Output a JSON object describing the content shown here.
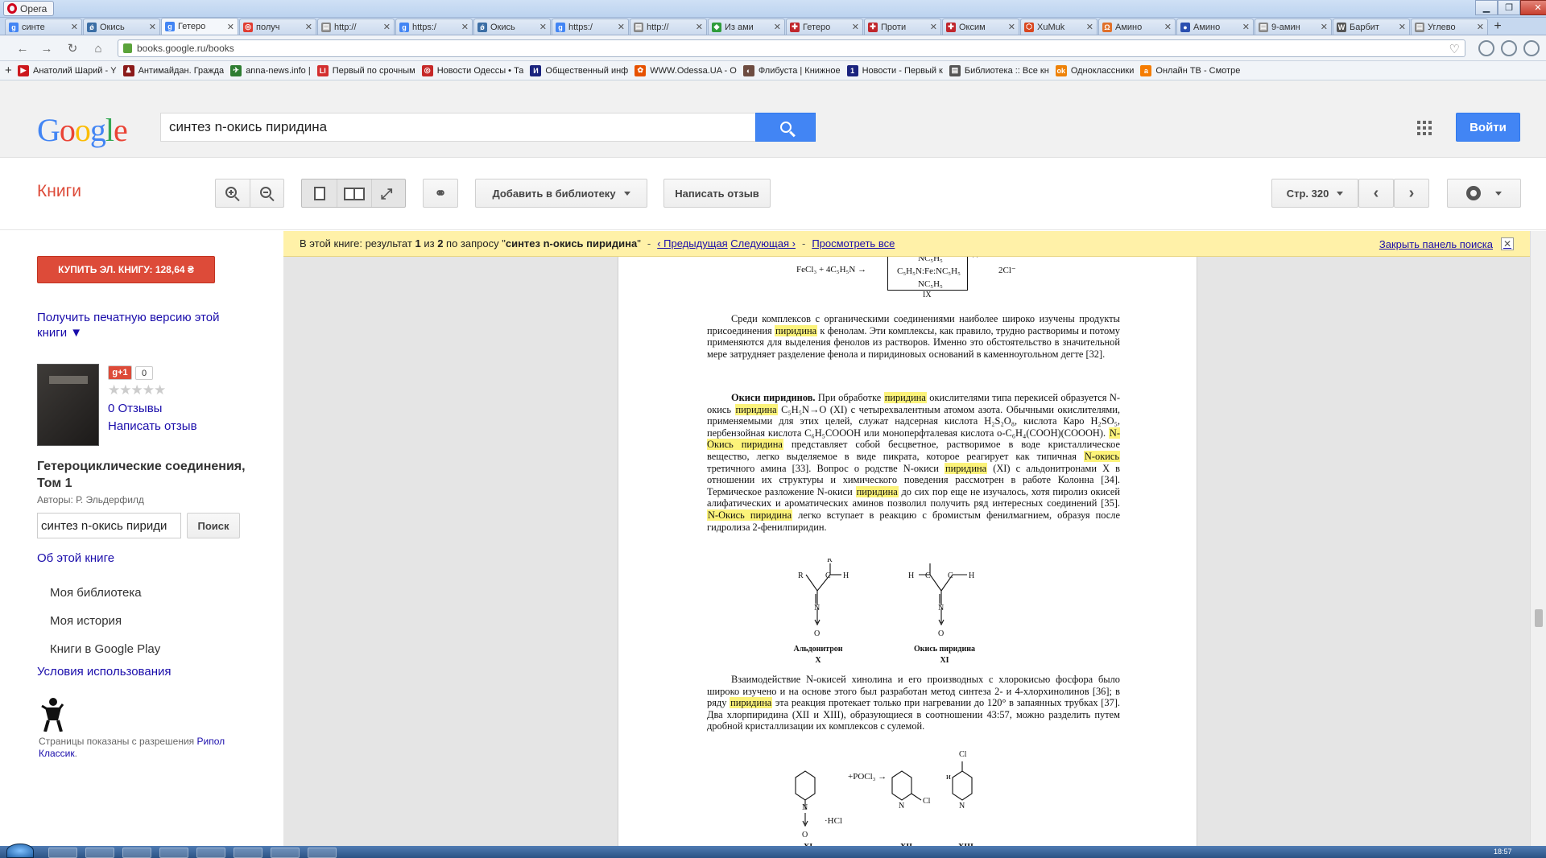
{
  "browser": {
    "app_name": "Opera",
    "tabs": [
      {
        "title": "синте",
        "fav": "g",
        "color": "#4285f4"
      },
      {
        "title": "Окись",
        "fav": "ǿ",
        "color": "#3b6ea5"
      },
      {
        "title": "Гетеро",
        "fav": "g",
        "color": "#4285f4",
        "active": true
      },
      {
        "title": "получ",
        "fav": "◎",
        "color": "#e03c31"
      },
      {
        "title": "http://",
        "fav": "▤",
        "color": "#888888"
      },
      {
        "title": "https:/",
        "fav": "g",
        "color": "#4285f4"
      },
      {
        "title": "Окись",
        "fav": "ǿ",
        "color": "#3b6ea5"
      },
      {
        "title": "https:/",
        "fav": "g",
        "color": "#4285f4"
      },
      {
        "title": "http://",
        "fav": "▤",
        "color": "#888888"
      },
      {
        "title": "Из ами",
        "fav": "◆",
        "color": "#2e9c3a"
      },
      {
        "title": "Гетеро",
        "fav": "✚",
        "color": "#c0262c"
      },
      {
        "title": "Проти",
        "fav": "✚",
        "color": "#c0262c"
      },
      {
        "title": "Оксим",
        "fav": "✚",
        "color": "#c0262c"
      },
      {
        "title": "XuMuk",
        "fav": "⬡",
        "color": "#d9461e"
      },
      {
        "title": "Амино",
        "fav": "Ω",
        "color": "#e0702a"
      },
      {
        "title": "Амино",
        "fav": "●",
        "color": "#2a4fb0"
      },
      {
        "title": "9-амин",
        "fav": "▤",
        "color": "#888888"
      },
      {
        "title": "Барбит",
        "fav": "W",
        "color": "#555555"
      },
      {
        "title": "Углево",
        "fav": "▤",
        "color": "#888888"
      }
    ],
    "url": "books.google.ru/books",
    "bookmarks": [
      {
        "title": "Анатолий Шарий - Y",
        "fav": "▶",
        "color": "#cc181e"
      },
      {
        "title": "Антимайдан. Гражда",
        "fav": "♟",
        "color": "#8b1a1a"
      },
      {
        "title": "anna-news.info |",
        "fav": "✈",
        "color": "#2e7d32"
      },
      {
        "title": "Первый по срочным",
        "fav": "LI",
        "color": "#d32f2f"
      },
      {
        "title": "Новости Одессы • Та",
        "fav": "◎",
        "color": "#c62828"
      },
      {
        "title": "Общественный инф",
        "fav": "И",
        "color": "#1a237e"
      },
      {
        "title": "WWW.Odessa.UA - О",
        "fav": "✿",
        "color": "#e65100"
      },
      {
        "title": "Флибуста | Книжное",
        "fav": "◐",
        "color": "#6d4c41"
      },
      {
        "title": "Новости - Первый к",
        "fav": "1",
        "color": "#1a237e"
      },
      {
        "title": "Библиотека :: Все кн",
        "fav": "▤",
        "color": "#555555"
      },
      {
        "title": "Одноклассники",
        "fav": "ok",
        "color": "#ee8208"
      },
      {
        "title": "Онлайн ТВ - Смотре",
        "fav": "a",
        "color": "#f57c00"
      }
    ]
  },
  "google": {
    "logo": [
      "G",
      "o",
      "o",
      "g",
      "l",
      "e"
    ],
    "logo_colors": [
      "#4285f4",
      "#ea4335",
      "#fbbc05",
      "#4285f4",
      "#34a853",
      "#ea4335"
    ],
    "query": "синтез n-окись пиридина",
    "signin": "Войти"
  },
  "toolbar": {
    "section": "Книги",
    "add_to_library": "Добавить в библиотеку",
    "write_review": "Написать отзыв",
    "page_select": "Стр. 320"
  },
  "sidebar": {
    "buy": "КУПИТЬ ЭЛ. КНИГУ: 128,64 ₴",
    "print_version": "Получить печатную версию этой книги ▼",
    "gplus": "g+1",
    "gplus_count": "0",
    "stars": "★★★★★",
    "reviews": "0 Отзывы",
    "write_review": "Написать отзыв",
    "book_title": "Гетероциклические соединения, Том 1",
    "authors": "Авторы: Р. Эльдерфилд",
    "search_value": "синтез n-окись пириди",
    "search_button": "Поиск",
    "about": "Об этой книге",
    "links": [
      "Моя библиотека",
      "Моя история",
      "Книги в Google Play"
    ],
    "terms": "Условия использования",
    "permission_text": "Страницы показаны с разрешения",
    "permission_link": "Рипол Классик",
    "permission_end": "."
  },
  "results_bar": {
    "prefix": "В этой книге: результат",
    "current": "1",
    "of": "из",
    "total": "2",
    "query_label": "по запросу \"",
    "query": "синтез n-окись пиридина",
    "query_end": "\"",
    "prev": "‹ Предыдущая",
    "next": "Следующая ›",
    "view_all": "Просмотреть все",
    "close": "Закрыть панель поиска",
    "close_x": "✕"
  },
  "page_text": {
    "top_formula_left": "FeCl₃ + 4C₅H₅N →",
    "top_formula_center_1": "NC₅H₅",
    "top_formula_center_2": "C₅H₅N:Fe:NC₅H₅",
    "top_formula_center_3": "NC₅H₅",
    "top_formula_label": "IX",
    "top_formula_right": "2Cl⁻",
    "top_formula_charge": "++",
    "struct_x_caption": "Альдонитрон",
    "struct_x_num": "X",
    "struct_xi_caption": "Окись пиридина",
    "struct_xi_num": "XI",
    "scheme_reagent": "+POCl₃ →",
    "scheme_and": "и",
    "scheme_hcl": "·HCl",
    "scheme_xi": "XI",
    "scheme_xii": "XII",
    "scheme_xiii": "XIII"
  },
  "clock": "18:57"
}
